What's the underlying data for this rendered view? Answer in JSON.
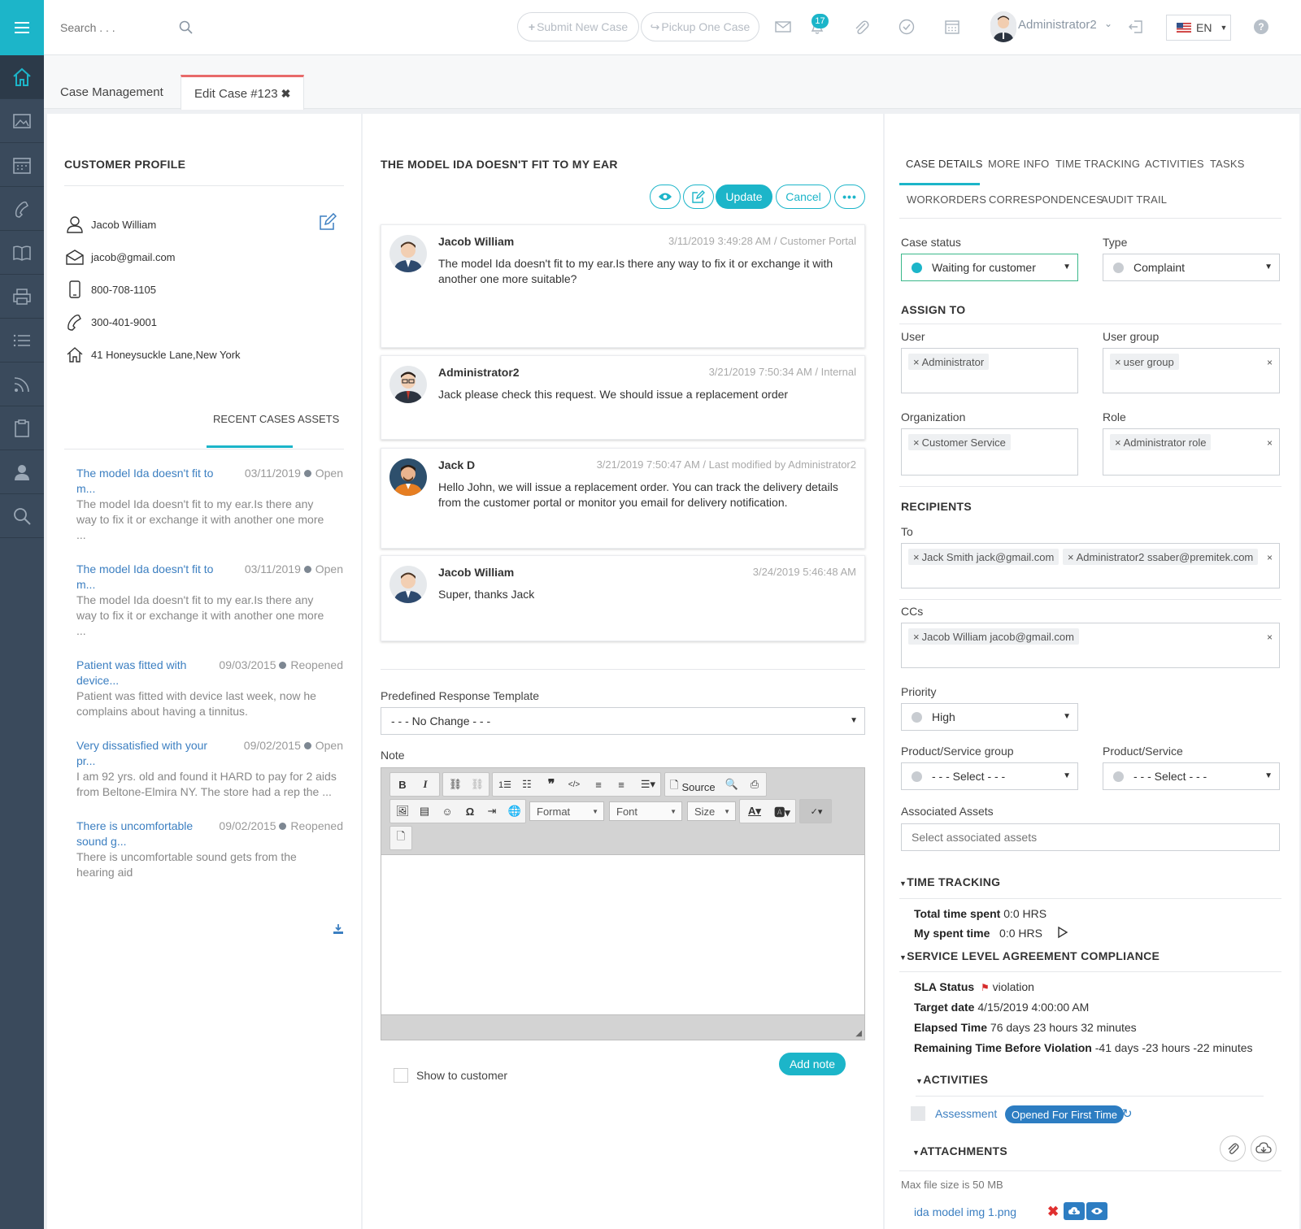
{
  "search": {
    "placeholder": "Search . . ."
  },
  "topbar": {
    "submit_label": "Submit New Case",
    "pickup_label": "Pickup One Case",
    "notif_count": "17",
    "user_name": "Administrator2",
    "lang": "EN"
  },
  "tabs": {
    "case_management": "Case Management",
    "edit_case": "Edit Case #123"
  },
  "profile": {
    "title": "CUSTOMER PROFILE",
    "name": "Jacob William",
    "email": "jacob@gmail.com",
    "mobile": "800-708-1105",
    "phone": "300-401-9001",
    "address": "41 Honeysuckle Lane,New York",
    "tab_recent": "RECENT CASES",
    "tab_assets": "ASSETS"
  },
  "recent_cases": [
    {
      "title": "The model Ida doesn't fit to",
      "title2": "m...",
      "date": "03/11/2019",
      "status": "Open",
      "body1": "The model Ida doesn't fit to my ear.Is there any",
      "body2": "way to fix it or exchange it with another one more",
      "body3": "..."
    },
    {
      "title": "The model Ida doesn't fit to",
      "title2": "m...",
      "date": "03/11/2019",
      "status": "Open",
      "body1": "The model Ida doesn't fit to my ear.Is there any",
      "body2": "way to fix it or exchange it with another one more",
      "body3": "..."
    },
    {
      "title": "Patient was fitted with",
      "title2": "device...",
      "date": "09/03/2015",
      "status": "Reopened",
      "body1": "Patient was fitted with device last week, now he",
      "body2": "complains about having a tinnitus.",
      "body3": ""
    },
    {
      "title": "Very dissatisfied with your",
      "title2": "pr...",
      "date": "09/02/2015",
      "status": "Open",
      "body1": "I am 92 yrs. old and found it HARD to pay for 2 aids",
      "body2": "from Beltone-Elmira NY. The store had a rep the ...",
      "body3": ""
    },
    {
      "title": "There is uncomfortable",
      "title2": "sound g...",
      "date": "09/02/2015",
      "status": "Reopened",
      "body1": "There is uncomfortable sound gets from the",
      "body2": "hearing aid",
      "body3": ""
    }
  ],
  "case": {
    "title": "THE MODEL IDA DOESN'T FIT TO MY EAR",
    "update_label": "Update",
    "cancel_label": "Cancel"
  },
  "comments": [
    {
      "author": "Jacob William",
      "meta": "3/11/2019 3:49:28 AM / Customer Portal",
      "msg": "The model Ida doesn't fit to my ear.Is there any way to fix it or exchange it with another one more suitable?"
    },
    {
      "author": "Administrator2",
      "meta": "3/21/2019 7:50:34 AM / Internal",
      "msg": "Jack please check this request. We should issue a replacement order"
    },
    {
      "author": "Jack D",
      "meta": "3/21/2019 7:50:47 AM / Last modified by Administrator2",
      "msg": "Hello John, we will issue a replacement order. You can track the delivery details from the customer portal or monitor you email for delivery notification."
    },
    {
      "author": "Jacob William",
      "meta": "3/24/2019 5:46:48 AM",
      "msg": "Super, thanks Jack"
    }
  ],
  "reply": {
    "template_label": "Predefined Response Template",
    "template_value": "- - - No Change - - -",
    "note_label": "Note",
    "toolbar_source": "Source",
    "toolbar_format": "Format",
    "toolbar_font": "Font",
    "toolbar_size": "Size",
    "show_customer": "Show to customer",
    "add_note": "Add note"
  },
  "details": {
    "tabs": [
      "CASE DETAILS",
      "MORE INFO",
      "TIME TRACKING",
      "ACTIVITIES",
      "TASKS",
      "WORKORDERS",
      "CORRESPONDENCES",
      "AUDIT TRAIL"
    ],
    "status_label": "Case status",
    "status_value": "Waiting for customer",
    "type_label": "Type",
    "type_value": "Complaint",
    "assign_title": "ASSIGN TO",
    "user_label": "User",
    "user_tag": "Administrator",
    "group_label": "User group",
    "group_tag": "user group",
    "org_label": "Organization",
    "org_tag": "Customer Service",
    "role_label": "Role",
    "role_tag": "Administrator role",
    "recipients_title": "RECIPIENTS",
    "to_label": "To",
    "to_tag1": "Jack Smith jack@gmail.com",
    "to_tag2": "Administrator2 ssaber@premitek.com",
    "cc_label": "CCs",
    "cc_tag": "Jacob William jacob@gmail.com",
    "priority_label": "Priority",
    "priority_value": "High",
    "psg_label": "Product/Service group",
    "psg_value": "- - - Select - - -",
    "ps_label": "Product/Service",
    "ps_value": "- - - Select - - -",
    "assets_label": "Associated Assets",
    "assets_placeholder": "Select associated assets",
    "time_title": "TIME TRACKING",
    "total_label": "Total time spent",
    "total_value": "0:0 HRS",
    "my_label": "My spent time",
    "my_value": "0:0 HRS",
    "sla_title": "SERVICE LEVEL AGREEMENT COMPLIANCE",
    "sla_status_label": "SLA Status",
    "sla_status_value": "violation",
    "target_label": "Target date",
    "target_value": "4/15/2019 4:00:00 AM",
    "elapsed_label": "Elapsed Time",
    "elapsed_value": "76 days 23 hours 32 minutes",
    "remaining_label": "Remaining Time Before Violation",
    "remaining_value": "-41 days -23 hours -22 minutes",
    "activities_title": "ACTIVITIES",
    "activity_name": "Assessment",
    "activity_badge": "Opened For First Time",
    "attachments_title": "ATTACHMENTS",
    "max_size": "Max file size is 50 MB",
    "file_name": "ida model img 1.png"
  },
  "colors": {
    "accent": "#1cb5c9",
    "sidebar": "#3a4a5c",
    "link": "#3c7fc1",
    "tab_active": "#e86a6a"
  }
}
